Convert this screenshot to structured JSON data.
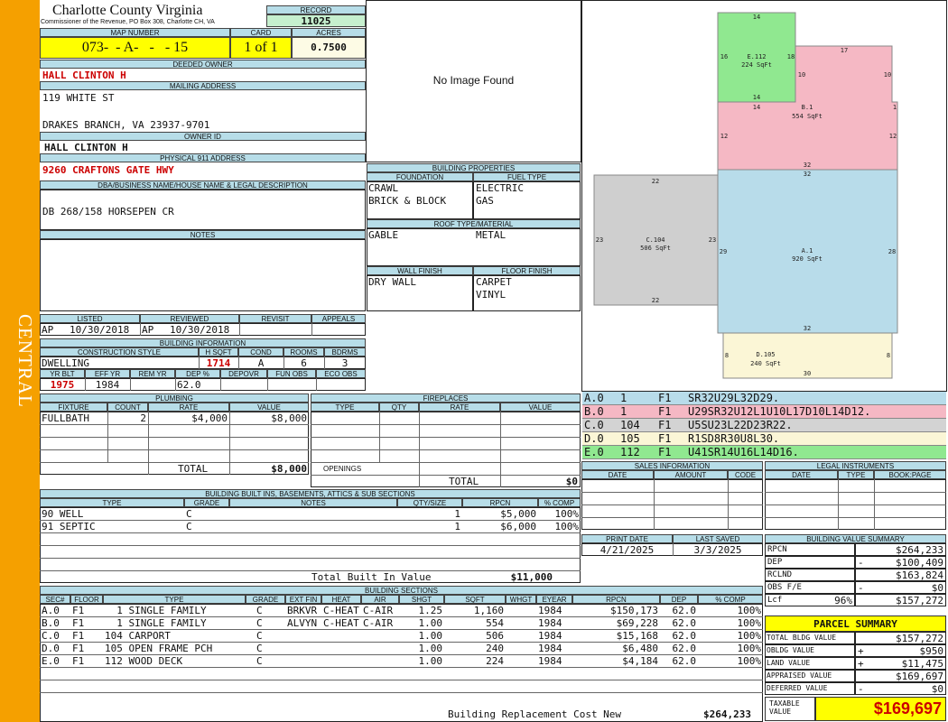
{
  "sidebar": {
    "label": "CENTRAL"
  },
  "header": {
    "county": "Charlotte County Virginia",
    "commissioner": "Commissioner of the Revenue, PO Box 308, Charlotte CH, VA",
    "record_label": "RECORD",
    "record": "11025",
    "map_number_label": "MAP NUMBER",
    "map_number": "073-  - A-   -   - 15",
    "card_label": "CARD",
    "card": "1 of 1",
    "acres_label": "ACRES",
    "acres": "0.7500"
  },
  "owner": {
    "deeded_owner_label": "DEEDED OWNER",
    "deeded_owner": "HALL CLINTON H",
    "mailing_label": "MAILING ADDRESS",
    "mailing_line1": "119 WHITE ST",
    "mailing_line2": "DRAKES BRANCH, VA 23937-9701",
    "owner_id_label": "OWNER ID",
    "owner_id": "HALL CLINTON H",
    "physical_label": "PHYSICAL 911 ADDRESS",
    "physical": "9260 CRAFTONS GATE HWY",
    "dba_label": "DBA/BUSINESS NAME/HOUSE NAME & LEGAL DESCRIPTION",
    "dba": "DB 268/158 HORSEPEN CR",
    "notes_label": "NOTES"
  },
  "photo": {
    "text": "No Image Found"
  },
  "building_properties": {
    "title": "BUILDING PROPERTIES",
    "foundation_label": "FOUNDATION",
    "foundation": [
      "CRAWL",
      "BRICK & BLOCK"
    ],
    "fuel_label": "FUEL TYPE",
    "fuel": [
      "ELECTRIC",
      "GAS"
    ],
    "roof_label": "ROOF TYPE/MATERIAL",
    "roof_type": "GABLE",
    "roof_material": "METAL",
    "wall_label": "WALL FINISH",
    "wall": "DRY WALL",
    "floor_label": "FLOOR FINISH",
    "floor": [
      "CARPET",
      "VINYL"
    ]
  },
  "status": {
    "listed_label": "LISTED",
    "listed_by": "AP",
    "listed_date": "10/30/2018",
    "reviewed_label": "REVIEWED",
    "reviewed_by": "AP",
    "reviewed_date": "10/30/2018",
    "revisit_label": "REVISIT",
    "appeals_label": "APPEALS"
  },
  "building_info": {
    "title": "BUILDING INFORMATION",
    "style_label": "CONSTRUCTION STYLE",
    "style": "DWELLING",
    "hsqft_label": "H SQFT",
    "hsqft": "1714",
    "cond_label": "COND",
    "cond": "A",
    "rooms_label": "ROOMS",
    "rooms": "6",
    "bdrms_label": "BDRMS",
    "bdrms": "3",
    "yrblt_label": "YR BLT",
    "yrblt": "1975",
    "effyr_label": "EFF YR",
    "effyr": "1984",
    "remyr_label": "REM YR",
    "dep_label": "DEP %",
    "dep": "62.0",
    "depovr_label": "DEPOVR",
    "funobs_label": "FUN OBS",
    "ecoobs_label": "ECO OBS"
  },
  "plumbing": {
    "title": "PLUMBING",
    "headers": [
      "FIXTURE",
      "COUNT",
      "RATE",
      "VALUE"
    ],
    "rows": [
      {
        "fixture": "FULLBATH",
        "count": "2",
        "rate": "$4,000",
        "value": "$8,000"
      }
    ],
    "total_label": "TOTAL",
    "total": "$8,000"
  },
  "fireplaces": {
    "title": "FIREPLACES",
    "headers": [
      "TYPE",
      "QTY",
      "RATE",
      "VALUE"
    ],
    "openings_label": "OPENINGS",
    "total_label": "TOTAL",
    "total": "$0"
  },
  "sketch": {
    "areas": [
      {
        "code": "E.112",
        "sqft": "224 SqFt"
      },
      {
        "code": "B.1",
        "sqft": "554 SqFt"
      },
      {
        "code": "A.1",
        "sqft": "920 SqFt"
      },
      {
        "code": "C.104",
        "sqft": "506 SqFt"
      },
      {
        "code": "D.105",
        "sqft": "240 SqFt"
      }
    ],
    "dims": [
      "14",
      "16",
      "18",
      "14",
      "17",
      "10",
      "10",
      "14",
      "1",
      "12",
      "12",
      "32",
      "32",
      "22",
      "23",
      "23",
      "29",
      "28",
      "22",
      "32",
      "8",
      "8",
      "30"
    ],
    "colors": {
      "green": "#90e890",
      "pink": "#f5b8c4",
      "blue": "#b8dcea",
      "gray": "#cfcfcf",
      "cream": "#fbf6d6"
    }
  },
  "sketch_legend": [
    {
      "code": "A.0",
      "n": "1",
      "f": "F1",
      "path": "SR32U29L32D29.",
      "color": "#b8dcea"
    },
    {
      "code": "B.0",
      "n": "1",
      "f": "F1",
      "path": "U29SR32U12L1U10L17D10L14D12.",
      "color": "#f5b8c4"
    },
    {
      "code": "C.0",
      "n": "104",
      "f": "F1",
      "path": "U5SU23L22D23R22.",
      "color": "#d3d3d3"
    },
    {
      "code": "D.0",
      "n": "105",
      "f": "F1",
      "path": "R1SD8R30U8L30.",
      "color": "#fbf6d6"
    },
    {
      "code": "E.0",
      "n": "112",
      "f": "F1",
      "path": "U41SR14U16L14D16.",
      "color": "#90e890"
    }
  ],
  "sales": {
    "title": "SALES INFORMATION",
    "headers": [
      "DATE",
      "AMOUNT",
      "CODE"
    ]
  },
  "legal": {
    "title": "LEGAL INSTRUMENTS",
    "headers": [
      "DATE",
      "TYPE",
      "BOOK:PAGE"
    ]
  },
  "dates": {
    "print_label": "PRINT DATE",
    "print": "4/21/2025",
    "saved_label": "LAST SAVED",
    "saved": "3/3/2025"
  },
  "builtins": {
    "title": "BUILDING BUILT INS, BASEMENTS, ATTICS & SUB SECTIONS",
    "headers": [
      "TYPE",
      "GRADE",
      "NOTES",
      "QTY/SIZE",
      "RPCN",
      "% COMP"
    ],
    "rows": [
      {
        "type": "90 WELL",
        "grade": "C",
        "notes": "",
        "qty": "1",
        "rpcn": "$5,000",
        "comp": "100%"
      },
      {
        "type": "91 SEPTIC",
        "grade": "C",
        "notes": "",
        "qty": "1",
        "rpcn": "$6,000",
        "comp": "100%"
      }
    ],
    "total_label": "Total Built In Value",
    "total": "$11,000"
  },
  "sections": {
    "title": "BUILDING SECTIONS",
    "headers": [
      "SEC#",
      "FLOOR",
      "TYPE",
      "GRADE",
      "EXT FIN",
      "HEAT",
      "AIR",
      "SHGT",
      "SQFT",
      "WHGT",
      "EYEAR",
      "RPCN",
      "DEP",
      "% COMP"
    ],
    "rows": [
      {
        "sec": "A.0",
        "floor": "F1",
        "type": "  1 SINGLE FAMILY",
        "grade": "C",
        "ext": "BRKVR",
        "heat": "C-HEAT",
        "air": "C-AIR",
        "shgt": "1.25",
        "sqft": "1,160",
        "whgt": "",
        "eyear": "1984",
        "rpcn": "$150,173",
        "dep": "62.0",
        "comp": "100%"
      },
      {
        "sec": "B.0",
        "floor": "F1",
        "type": "  1 SINGLE FAMILY",
        "grade": "C",
        "ext": "ALVYN",
        "heat": "C-HEAT",
        "air": "C-AIR",
        "shgt": "1.00",
        "sqft": "554",
        "whgt": "",
        "eyear": "1984",
        "rpcn": "$69,228",
        "dep": "62.0",
        "comp": "100%"
      },
      {
        "sec": "C.0",
        "floor": "F1",
        "type": "104 CARPORT",
        "grade": "C",
        "ext": "",
        "heat": "",
        "air": "",
        "shgt": "1.00",
        "sqft": "506",
        "whgt": "",
        "eyear": "1984",
        "rpcn": "$15,168",
        "dep": "62.0",
        "comp": "100%"
      },
      {
        "sec": "D.0",
        "floor": "F1",
        "type": "105 OPEN FRAME PCH",
        "grade": "C",
        "ext": "",
        "heat": "",
        "air": "",
        "shgt": "1.00",
        "sqft": "240",
        "whgt": "",
        "eyear": "1984",
        "rpcn": "$6,480",
        "dep": "62.0",
        "comp": "100%"
      },
      {
        "sec": "E.0",
        "floor": "F1",
        "type": "112 WOOD DECK",
        "grade": "C",
        "ext": "",
        "heat": "",
        "air": "",
        "shgt": "1.00",
        "sqft": "224",
        "whgt": "",
        "eyear": "1984",
        "rpcn": "$4,184",
        "dep": "62.0",
        "comp": "100%"
      }
    ],
    "footer_label": "Building Replacement Cost New",
    "footer": "$264,233"
  },
  "value_summary": {
    "title": "BUILDING VALUE SUMMARY",
    "rows": [
      {
        "label": "RPCN",
        "sign": "",
        "value": "$264,233"
      },
      {
        "label": "DEP",
        "sign": "-",
        "value": "$100,409"
      },
      {
        "label": "RCLND",
        "sign": "",
        "value": "$163,824"
      },
      {
        "label": "OBS F/E",
        "sign": "-",
        "value": "$0"
      },
      {
        "label": "Lcf",
        "pct": "96%",
        "sign": "",
        "value": "$157,272"
      }
    ]
  },
  "parcel_summary": {
    "title": "PARCEL SUMMARY",
    "rows": [
      {
        "label": "TOTAL BLDG VALUE",
        "sign": "",
        "value": "$157,272"
      },
      {
        "label": "OBLDG VALUE",
        "sign": "+",
        "value": "$950"
      },
      {
        "label": "LAND VALUE",
        "sign": "+",
        "value": "$11,475"
      },
      {
        "label": "APPRAISED VALUE",
        "sign": "",
        "value": "$169,697"
      },
      {
        "label": "DEFERRED VALUE",
        "sign": "-",
        "value": "$0"
      }
    ],
    "taxable_label": "TAXABLE VALUE",
    "taxable": "$169,697"
  }
}
